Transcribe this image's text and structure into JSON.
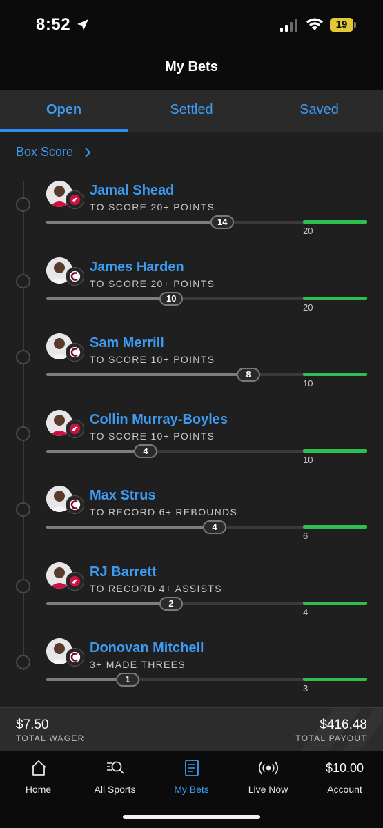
{
  "status_bar": {
    "time": "8:52",
    "battery": "19"
  },
  "header": {
    "title": "My Bets"
  },
  "tabs": [
    {
      "label": "Open",
      "active": true
    },
    {
      "label": "Settled",
      "active": false
    },
    {
      "label": "Saved",
      "active": false
    }
  ],
  "box_score_link": "Box Score",
  "legs": [
    {
      "player": "Jamal Shead",
      "team": "raptors",
      "market": "TO SCORE 20+ POINTS",
      "current": "14",
      "target": "20",
      "progress": 0.7
    },
    {
      "player": "James Harden",
      "team": "cavaliers",
      "market": "TO SCORE 20+ POINTS",
      "current": "10",
      "target": "20",
      "progress": 0.5
    },
    {
      "player": "Sam Merrill",
      "team": "cavaliers",
      "market": "TO SCORE 10+ POINTS",
      "current": "8",
      "target": "10",
      "progress": 0.8
    },
    {
      "player": "Collin Murray-Boyles",
      "team": "raptors",
      "market": "TO SCORE 10+ POINTS",
      "current": "4",
      "target": "10",
      "progress": 0.4
    },
    {
      "player": "Max Strus",
      "team": "cavaliers",
      "market": "TO RECORD 6+ REBOUNDS",
      "current": "4",
      "target": "6",
      "progress": 0.67
    },
    {
      "player": "RJ Barrett",
      "team": "raptors",
      "market": "TO RECORD 4+ ASSISTS",
      "current": "2",
      "target": "4",
      "progress": 0.5
    },
    {
      "player": "Donovan Mitchell",
      "team": "cavaliers",
      "market": "3+ MADE THREES",
      "current": "1",
      "target": "3",
      "progress": 0.33
    }
  ],
  "summary": {
    "wager_amount": "$7.50",
    "wager_label": "TOTAL WAGER",
    "payout_amount": "$416.48",
    "payout_label": "TOTAL PAYOUT"
  },
  "nav": [
    {
      "label": "Home",
      "icon": "home-icon",
      "active": false
    },
    {
      "label": "All Sports",
      "icon": "search-sports-icon",
      "active": false
    },
    {
      "label": "My Bets",
      "icon": "bet-slip-icon",
      "active": true
    },
    {
      "label": "Live Now",
      "icon": "live-icon",
      "active": false
    },
    {
      "label": "Account",
      "balance": "$10.00",
      "active": false
    }
  ],
  "colors": {
    "accent": "#3d9bf2",
    "success": "#2fbf4f",
    "raptors": "#ce1141",
    "cavaliers": "#860038"
  }
}
